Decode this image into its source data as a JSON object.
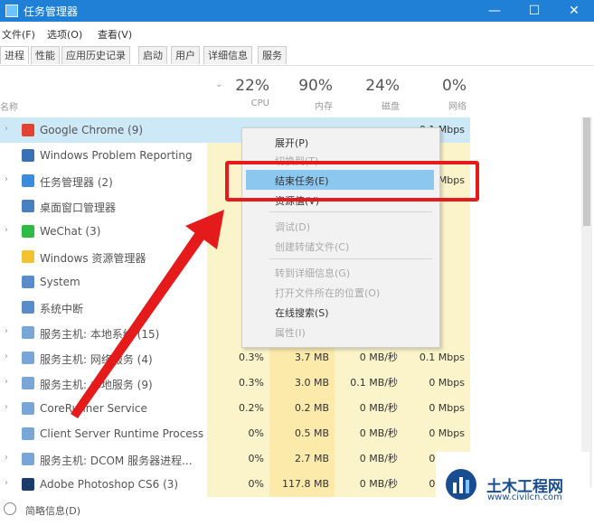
{
  "window": {
    "title": "任务管理器",
    "minimize": "—",
    "maximize": "☐",
    "close": "✕"
  },
  "menubar": [
    "文件(F)",
    "选项(O)",
    "查看(V)"
  ],
  "tabs": [
    "进程",
    "性能",
    "应用历史记录",
    "启动",
    "用户",
    "详细信息",
    "服务"
  ],
  "columns": {
    "name": "名称",
    "cpu": {
      "pct": "22%",
      "label": "CPU"
    },
    "memory": {
      "pct": "90%",
      "label": "内存"
    },
    "disk": {
      "pct": "24%",
      "label": "磁盘"
    },
    "network": {
      "pct": "0%",
      "label": "网络"
    }
  },
  "processes": [
    {
      "name": "Google Chrome (9)",
      "cpu": "",
      "mem": "",
      "disk": "",
      "net": "0.1 Mbps",
      "expand": true,
      "icon": "chrome-icon",
      "color": "#e34133"
    },
    {
      "name": "Windows Problem Reporting",
      "cpu": "",
      "mem": "",
      "disk": "",
      "net": "",
      "expand": false,
      "icon": "report-icon",
      "color": "#3b6fb5"
    },
    {
      "name": "任务管理器 (2)",
      "cpu": "",
      "mem": "",
      "disk": "",
      "net": "Mbps",
      "expand": true,
      "icon": "taskmgr-icon",
      "color": "#3c8bd8"
    },
    {
      "name": "桌面窗口管理器",
      "cpu": "",
      "mem": "",
      "disk": "",
      "net": "",
      "expand": false,
      "icon": "dwm-icon",
      "color": "#4a7fc1"
    },
    {
      "name": "WeChat (3)",
      "cpu": "",
      "mem": "",
      "disk": "",
      "net": "",
      "expand": true,
      "icon": "wechat-icon",
      "color": "#2dbb47"
    },
    {
      "name": "Windows 资源管理器",
      "cpu": "",
      "mem": "",
      "disk": "",
      "net": "",
      "expand": false,
      "icon": "explorer-icon",
      "color": "#f1c232"
    },
    {
      "name": "System",
      "cpu": "",
      "mem": "",
      "disk": "",
      "net": "",
      "expand": false,
      "icon": "system-icon",
      "color": "#5a8dc8"
    },
    {
      "name": "系统中断",
      "cpu": "",
      "mem": "",
      "disk": "",
      "net": "",
      "expand": false,
      "icon": "interrupt-icon",
      "color": "#5a8dc8"
    },
    {
      "name": "服务主机: 本地系统 (15)",
      "cpu": "",
      "mem": "",
      "disk": "",
      "net": "",
      "expand": true,
      "icon": "gear-icon",
      "color": "#7aa6d6"
    },
    {
      "name": "服务主机: 网络服务 (4)",
      "cpu": "0.3%",
      "mem": "3.7 MB",
      "disk": "0 MB/秒",
      "net": "0.1 Mbps",
      "expand": true,
      "icon": "gear-icon",
      "color": "#7aa6d6"
    },
    {
      "name": "服务主机: 本地服务 (9)",
      "cpu": "0.3%",
      "mem": "3.0 MB",
      "disk": "0.1 MB/秒",
      "net": "0 Mbps",
      "expand": true,
      "icon": "gear-icon",
      "color": "#7aa6d6"
    },
    {
      "name": "CoreRunner Service",
      "cpu": "0.2%",
      "mem": "0.2 MB",
      "disk": "0 MB/秒",
      "net": "0 Mbps",
      "expand": true,
      "icon": "service-icon",
      "color": "#7aa6d6"
    },
    {
      "name": "Client Server Runtime Process",
      "cpu": "0%",
      "mem": "0.5 MB",
      "disk": "0 MB/秒",
      "net": "0 Mbps",
      "expand": false,
      "icon": "csrss-icon",
      "color": "#7aa6d6"
    },
    {
      "name": "服务主机: DCOM 服务器进程...",
      "cpu": "0%",
      "mem": "2.7 MB",
      "disk": "0 MB/秒",
      "net": "0 Mbps",
      "expand": true,
      "icon": "gear-icon",
      "color": "#7aa6d6"
    },
    {
      "name": "Adobe Photoshop CS6 (3)",
      "cpu": "0%",
      "mem": "117.8 MB",
      "disk": "0 MB/秒",
      "net": "0 Mbps",
      "expand": true,
      "icon": "photoshop-icon",
      "color": "#1a3a6a"
    }
  ],
  "context_menu": {
    "items": [
      {
        "label": "展开(P)",
        "disabled": false
      },
      {
        "label": "切换到(T)",
        "disabled": true
      },
      {
        "label": "结束任务(E)",
        "disabled": false,
        "highlighted": true
      },
      {
        "label": "资源值(V)",
        "disabled": false
      },
      {
        "label": "调试(D)",
        "disabled": true
      },
      {
        "label": "创建转储文件(C)",
        "disabled": true
      },
      {
        "label": "转到详细信息(G)",
        "disabled": true
      },
      {
        "label": "打开文件所在的位置(O)",
        "disabled": true
      },
      {
        "label": "在线搜索(S)",
        "disabled": false
      },
      {
        "label": "属性(I)",
        "disabled": true
      }
    ]
  },
  "footer": {
    "label": "简略信息(D)"
  },
  "watermark": {
    "title": "土木工程网",
    "url": "www.civilcn.com"
  },
  "annotation_color": "#e51b1b"
}
